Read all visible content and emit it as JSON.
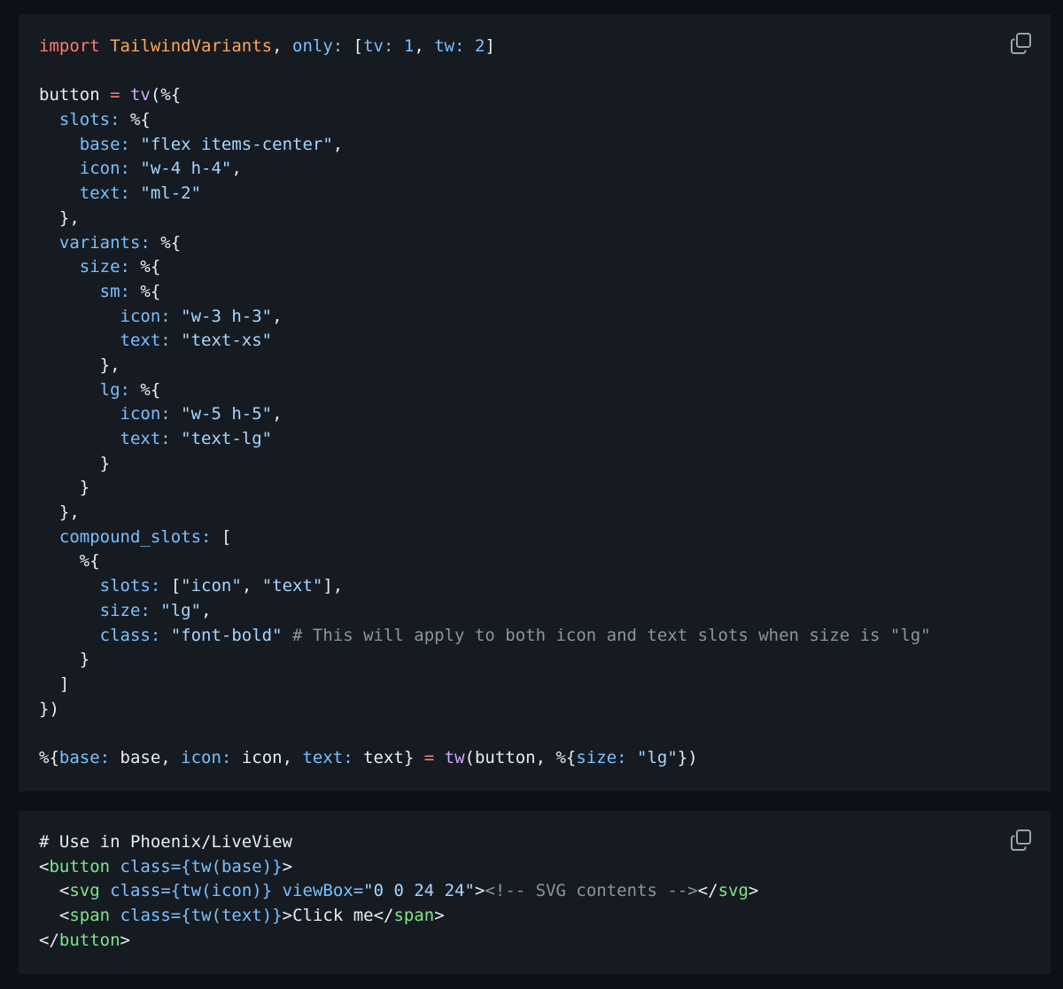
{
  "colors": {
    "page_background": "#0d1117",
    "block_background": "#161b22",
    "keyword": "#ff7b72",
    "module": "#ffa657",
    "atom": "#79c0ff",
    "string": "#a5d6ff",
    "function": "#d2a8ff",
    "comment": "#8b949e",
    "tag": "#7ee787",
    "text": "#e6edf3"
  },
  "blocks": [
    {
      "copy_icon": "copy-icon",
      "lines": [
        [
          [
            "kw",
            "import"
          ],
          [
            "txt",
            " "
          ],
          [
            "mod",
            "TailwindVariants"
          ],
          [
            "pun",
            ", "
          ],
          [
            "key",
            "only:"
          ],
          [
            "pun",
            " ["
          ],
          [
            "key",
            "tv:"
          ],
          [
            "pun",
            " "
          ],
          [
            "num",
            "1"
          ],
          [
            "pun",
            ", "
          ],
          [
            "key",
            "tw:"
          ],
          [
            "pun",
            " "
          ],
          [
            "num",
            "2"
          ],
          [
            "pun",
            "]"
          ]
        ],
        [],
        [
          [
            "txt",
            "button "
          ],
          [
            "op",
            "="
          ],
          [
            "txt",
            " "
          ],
          [
            "fn",
            "tv"
          ],
          [
            "pun",
            "(%{"
          ]
        ],
        [
          [
            "txt",
            "  "
          ],
          [
            "key",
            "slots:"
          ],
          [
            "pun",
            " %{"
          ]
        ],
        [
          [
            "txt",
            "    "
          ],
          [
            "key",
            "base:"
          ],
          [
            "txt",
            " "
          ],
          [
            "str",
            "\"flex items-center\""
          ],
          [
            "pun",
            ","
          ]
        ],
        [
          [
            "txt",
            "    "
          ],
          [
            "key",
            "icon:"
          ],
          [
            "txt",
            " "
          ],
          [
            "str",
            "\"w-4 h-4\""
          ],
          [
            "pun",
            ","
          ]
        ],
        [
          [
            "txt",
            "    "
          ],
          [
            "key",
            "text:"
          ],
          [
            "txt",
            " "
          ],
          [
            "str",
            "\"ml-2\""
          ]
        ],
        [
          [
            "txt",
            "  "
          ],
          [
            "pun",
            "},"
          ]
        ],
        [
          [
            "txt",
            "  "
          ],
          [
            "key",
            "variants:"
          ],
          [
            "pun",
            " %{"
          ]
        ],
        [
          [
            "txt",
            "    "
          ],
          [
            "key",
            "size:"
          ],
          [
            "pun",
            " %{"
          ]
        ],
        [
          [
            "txt",
            "      "
          ],
          [
            "key",
            "sm:"
          ],
          [
            "pun",
            " %{"
          ]
        ],
        [
          [
            "txt",
            "        "
          ],
          [
            "key",
            "icon:"
          ],
          [
            "txt",
            " "
          ],
          [
            "str",
            "\"w-3 h-3\""
          ],
          [
            "pun",
            ","
          ]
        ],
        [
          [
            "txt",
            "        "
          ],
          [
            "key",
            "text:"
          ],
          [
            "txt",
            " "
          ],
          [
            "str",
            "\"text-xs\""
          ]
        ],
        [
          [
            "txt",
            "      "
          ],
          [
            "pun",
            "},"
          ]
        ],
        [
          [
            "txt",
            "      "
          ],
          [
            "key",
            "lg:"
          ],
          [
            "pun",
            " %{"
          ]
        ],
        [
          [
            "txt",
            "        "
          ],
          [
            "key",
            "icon:"
          ],
          [
            "txt",
            " "
          ],
          [
            "str",
            "\"w-5 h-5\""
          ],
          [
            "pun",
            ","
          ]
        ],
        [
          [
            "txt",
            "        "
          ],
          [
            "key",
            "text:"
          ],
          [
            "txt",
            " "
          ],
          [
            "str",
            "\"text-lg\""
          ]
        ],
        [
          [
            "txt",
            "      "
          ],
          [
            "pun",
            "}"
          ]
        ],
        [
          [
            "txt",
            "    "
          ],
          [
            "pun",
            "}"
          ]
        ],
        [
          [
            "txt",
            "  "
          ],
          [
            "pun",
            "},"
          ]
        ],
        [
          [
            "txt",
            "  "
          ],
          [
            "key",
            "compound_slots:"
          ],
          [
            "pun",
            " ["
          ]
        ],
        [
          [
            "txt",
            "    "
          ],
          [
            "pun",
            "%{"
          ]
        ],
        [
          [
            "txt",
            "      "
          ],
          [
            "key",
            "slots:"
          ],
          [
            "pun",
            " ["
          ],
          [
            "str",
            "\"icon\""
          ],
          [
            "pun",
            ", "
          ],
          [
            "str",
            "\"text\""
          ],
          [
            "pun",
            "],"
          ]
        ],
        [
          [
            "txt",
            "      "
          ],
          [
            "key",
            "size:"
          ],
          [
            "txt",
            " "
          ],
          [
            "str",
            "\"lg\""
          ],
          [
            "pun",
            ","
          ]
        ],
        [
          [
            "txt",
            "      "
          ],
          [
            "key",
            "class:"
          ],
          [
            "txt",
            " "
          ],
          [
            "str",
            "\"font-bold\""
          ],
          [
            "txt",
            " "
          ],
          [
            "cmt",
            "# This will apply to both icon and text slots when size is \"lg\""
          ]
        ],
        [
          [
            "txt",
            "    "
          ],
          [
            "pun",
            "}"
          ]
        ],
        [
          [
            "txt",
            "  "
          ],
          [
            "pun",
            "]"
          ]
        ],
        [
          [
            "pun",
            "})"
          ]
        ],
        [],
        [
          [
            "pun",
            "%{"
          ],
          [
            "key",
            "base:"
          ],
          [
            "txt",
            " base, "
          ],
          [
            "key",
            "icon:"
          ],
          [
            "txt",
            " icon, "
          ],
          [
            "key",
            "text:"
          ],
          [
            "txt",
            " text} "
          ],
          [
            "op",
            "="
          ],
          [
            "txt",
            " "
          ],
          [
            "fn",
            "tw"
          ],
          [
            "pun",
            "(button, %{"
          ],
          [
            "key",
            "size:"
          ],
          [
            "txt",
            " "
          ],
          [
            "str",
            "\"lg\""
          ],
          [
            "pun",
            "})"
          ]
        ]
      ]
    },
    {
      "copy_icon": "copy-icon",
      "lines": [
        [
          [
            "txt",
            "# Use in Phoenix/LiveView"
          ]
        ],
        [
          [
            "pun",
            "<"
          ],
          [
            "tag",
            "button"
          ],
          [
            "txt",
            " "
          ],
          [
            "attr",
            "class"
          ],
          [
            "eq",
            "="
          ],
          [
            "attr",
            "{tw(base)}"
          ],
          [
            "pun",
            ">"
          ]
        ],
        [
          [
            "txt",
            "  "
          ],
          [
            "pun",
            "<"
          ],
          [
            "tag",
            "svg"
          ],
          [
            "txt",
            " "
          ],
          [
            "attr",
            "class"
          ],
          [
            "eq",
            "="
          ],
          [
            "attr",
            "{tw(icon)}"
          ],
          [
            "txt",
            " "
          ],
          [
            "attr",
            "viewBox"
          ],
          [
            "eq",
            "="
          ],
          [
            "str",
            "\"0 0 24 24\""
          ],
          [
            "pun",
            ">"
          ],
          [
            "cmt",
            "<!-- SVG contents -->"
          ],
          [
            "pun",
            "</"
          ],
          [
            "tag",
            "svg"
          ],
          [
            "pun",
            ">"
          ]
        ],
        [
          [
            "txt",
            "  "
          ],
          [
            "pun",
            "<"
          ],
          [
            "tag",
            "span"
          ],
          [
            "txt",
            " "
          ],
          [
            "attr",
            "class"
          ],
          [
            "eq",
            "="
          ],
          [
            "attr",
            "{tw(text)}"
          ],
          [
            "pun",
            ">"
          ],
          [
            "txt",
            "Click me"
          ],
          [
            "pun",
            "</"
          ],
          [
            "tag",
            "span"
          ],
          [
            "pun",
            ">"
          ]
        ],
        [
          [
            "pun",
            "</"
          ],
          [
            "tag",
            "button"
          ],
          [
            "pun",
            ">"
          ]
        ]
      ]
    }
  ]
}
